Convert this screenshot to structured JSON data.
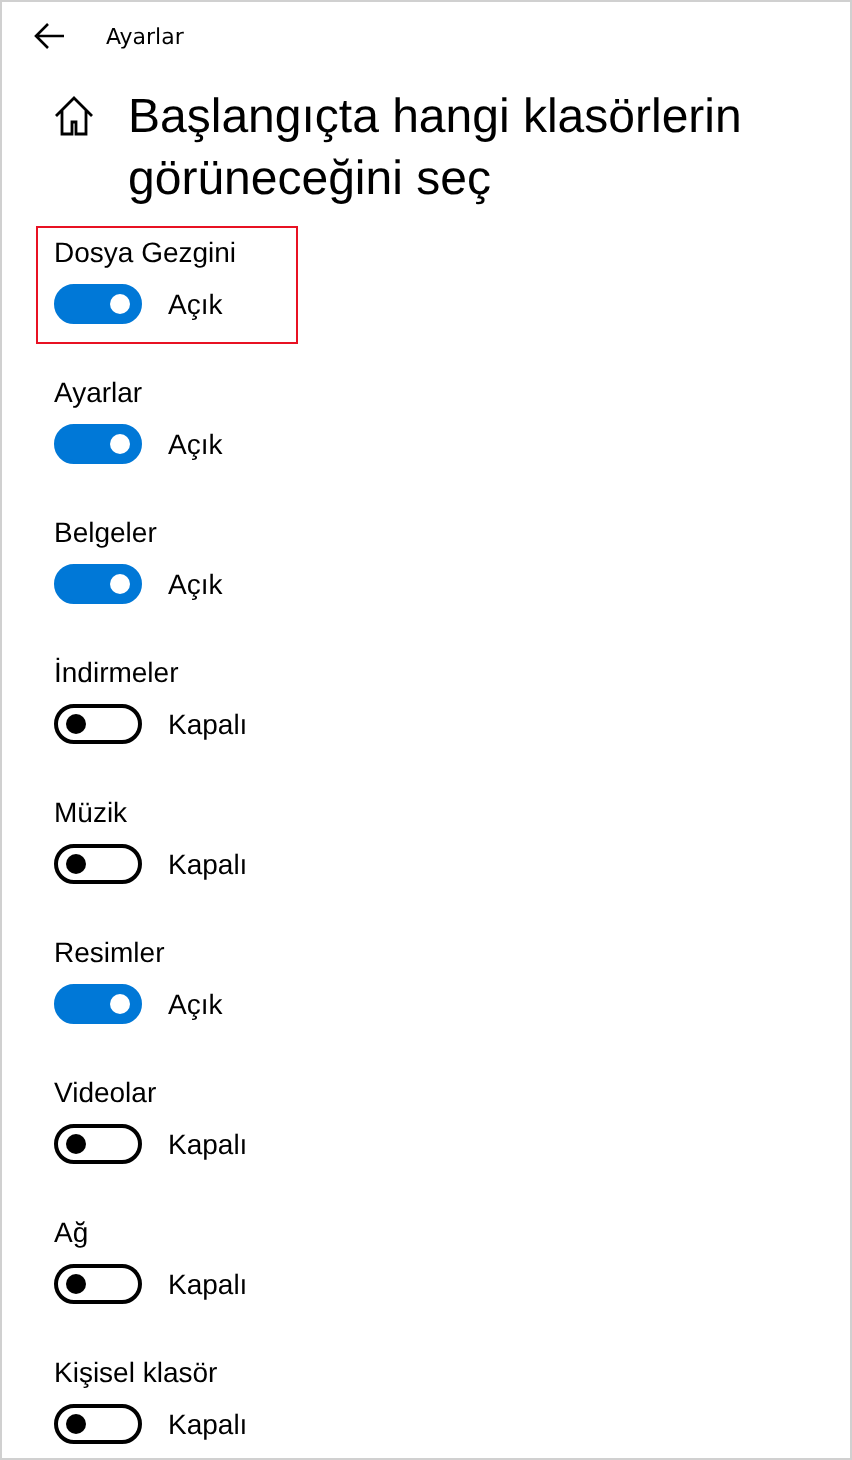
{
  "window": {
    "title": "Ayarlar"
  },
  "heading": "Başlangıçta hangi klasörlerin görüneceğini seç",
  "items": [
    {
      "label": "Dosya Gezgini",
      "on": true,
      "state_text": "Açık",
      "highlighted": true
    },
    {
      "label": "Ayarlar",
      "on": true,
      "state_text": "Açık",
      "highlighted": false
    },
    {
      "label": "Belgeler",
      "on": true,
      "state_text": "Açık",
      "highlighted": false
    },
    {
      "label": "İndirmeler",
      "on": false,
      "state_text": "Kapalı",
      "highlighted": false
    },
    {
      "label": "Müzik",
      "on": false,
      "state_text": "Kapalı",
      "highlighted": false
    },
    {
      "label": "Resimler",
      "on": true,
      "state_text": "Açık",
      "highlighted": false
    },
    {
      "label": "Videolar",
      "on": false,
      "state_text": "Kapalı",
      "highlighted": false
    },
    {
      "label": "Ağ",
      "on": false,
      "state_text": "Kapalı",
      "highlighted": false
    },
    {
      "label": "Kişisel klasör",
      "on": false,
      "state_text": "Kapalı",
      "highlighted": false
    }
  ]
}
